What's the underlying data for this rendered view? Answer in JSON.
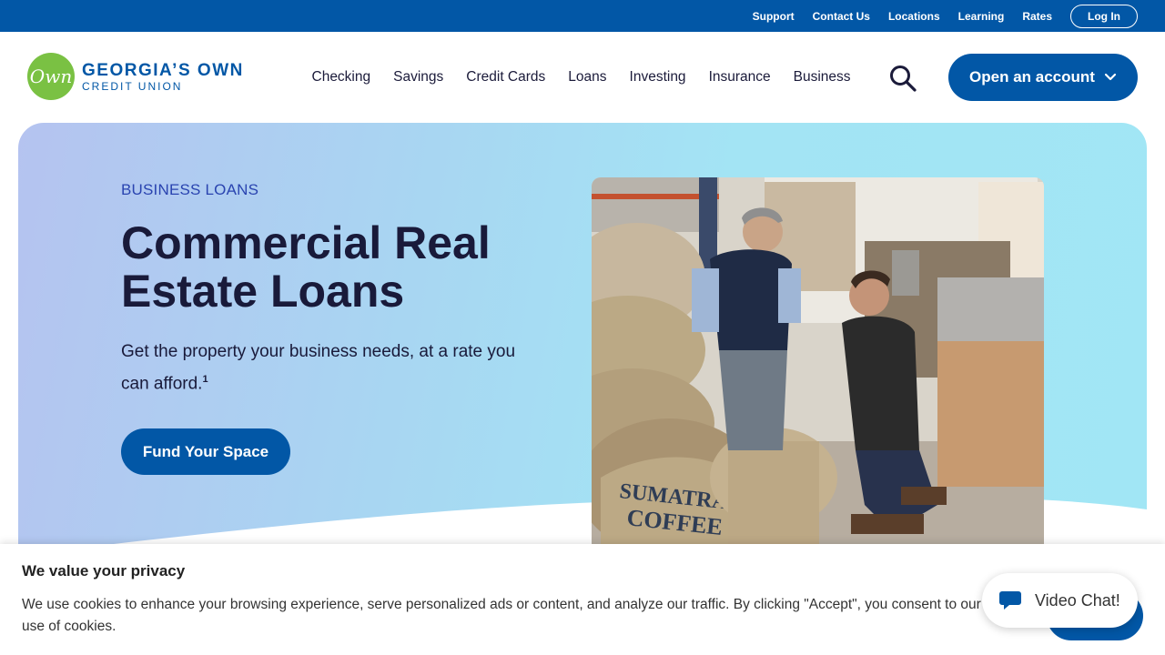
{
  "utility": {
    "links": [
      "Support",
      "Contact Us",
      "Locations",
      "Learning",
      "Rates"
    ],
    "login_label": "Log In"
  },
  "logo": {
    "mark": "Own",
    "line1": "GEORGIA’S OWN",
    "line2": "CREDIT UNION"
  },
  "nav": {
    "items": [
      "Checking",
      "Savings",
      "Credit Cards",
      "Loans",
      "Investing",
      "Insurance",
      "Business"
    ],
    "search_icon": "search-icon",
    "cta_label": "Open an account"
  },
  "hero": {
    "eyebrow": "BUSINESS LOANS",
    "title": "Commercial Real Estate Loans",
    "subtitle": "Get the property your business needs, at a rate you can afford.",
    "footnote": "1",
    "button_label": "Fund Your Space",
    "photo_text": "SUMATRA COFFEE"
  },
  "cookie": {
    "title": "We value your privacy",
    "text": "We use cookies to enhance your browsing experience, serve personalized ads or content, and analyze our traffic. By clicking \"Accept\", you consent to our use of cookies."
  },
  "chat": {
    "label": "Video Chat!"
  },
  "colors": {
    "brand_blue": "#0257a6",
    "logo_green": "#7ac143",
    "eyebrow_blue": "#2a44b0"
  }
}
